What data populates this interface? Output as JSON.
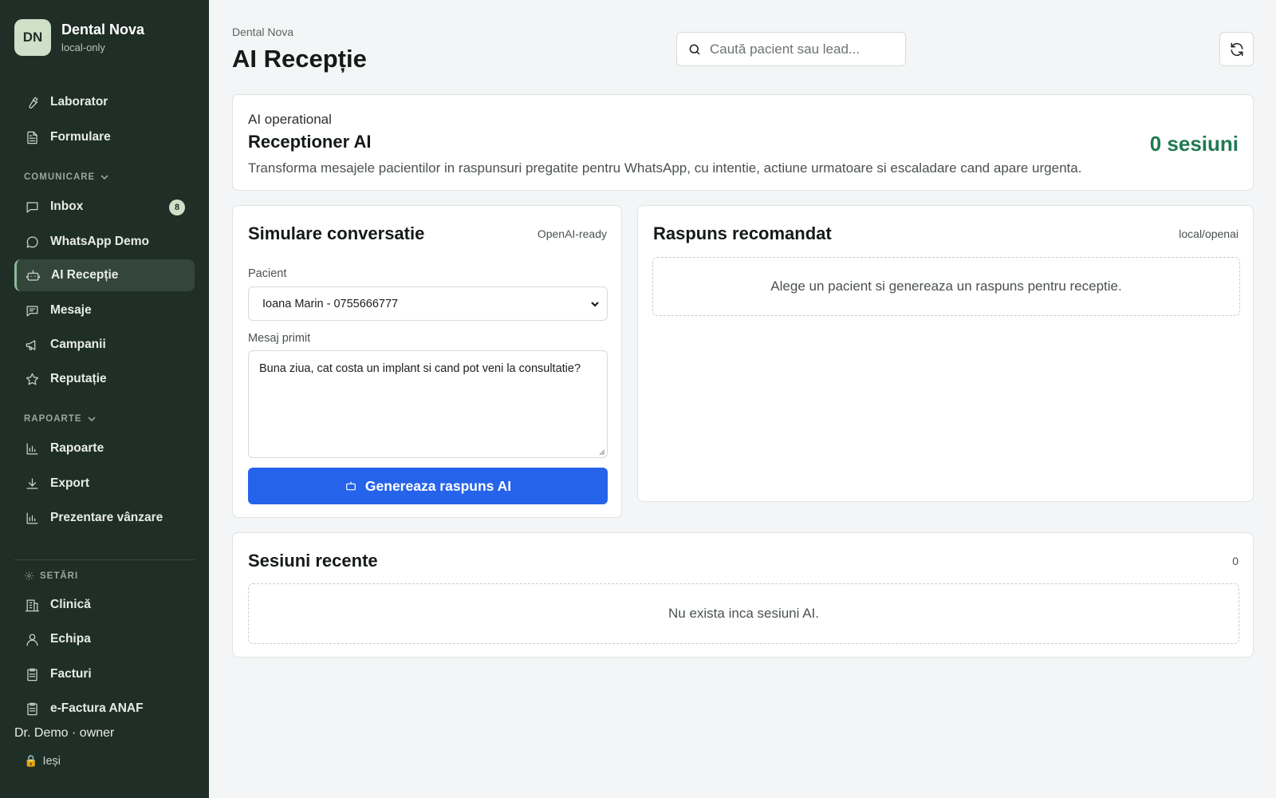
{
  "brand": {
    "initials": "DN",
    "name": "Dental Nova",
    "subtitle": "local-only"
  },
  "sidebar": {
    "items_top": [
      {
        "label": "Laborator",
        "icon": "wrench-icon"
      },
      {
        "label": "Formulare",
        "icon": "document-icon"
      }
    ],
    "section_comunicare": "COMUNICARE",
    "items_comunicare": [
      {
        "label": "Inbox",
        "icon": "message-square-icon",
        "badge": "8"
      },
      {
        "label": "WhatsApp Demo",
        "icon": "message-circle-icon"
      },
      {
        "label": "AI Recepție",
        "icon": "bot-icon",
        "active": true
      },
      {
        "label": "Mesaje",
        "icon": "message-lines-icon"
      },
      {
        "label": "Campanii",
        "icon": "megaphone-icon"
      },
      {
        "label": "Reputație",
        "icon": "star-icon"
      }
    ],
    "section_rapoarte": "RAPOARTE",
    "items_rapoarte": [
      {
        "label": "Rapoarte",
        "icon": "bar-chart-icon"
      },
      {
        "label": "Export",
        "icon": "download-icon"
      },
      {
        "label": "Prezentare vânzare",
        "icon": "bar-chart-icon"
      }
    ],
    "section_setari": "SETĂRI",
    "items_setari": [
      {
        "label": "Clinică",
        "icon": "building-icon"
      },
      {
        "label": "Echipa",
        "icon": "user-icon"
      },
      {
        "label": "Facturi",
        "icon": "clipboard-icon"
      },
      {
        "label": "e-Factura ANAF",
        "icon": "clipboard-icon"
      }
    ],
    "user": "Dr. Demo · owner",
    "logout": "Ieși"
  },
  "header": {
    "breadcrumb": "Dental Nova",
    "title": "AI Recepție",
    "search_placeholder": "Caută pacient sau lead..."
  },
  "hero": {
    "kicker": "AI operational",
    "title": "Receptioner AI",
    "description": "Transforma mesajele pacientilor in raspunsuri pregatite pentru WhatsApp, cu intentie, actiune urmatoare si escaladare cand apare urgenta.",
    "count": "0 sesiuni"
  },
  "simulation": {
    "title": "Simulare conversatie",
    "meta": "OpenAI-ready",
    "patient_label": "Pacient",
    "patient_value": "Ioana Marin - 0755666777",
    "message_label": "Mesaj primit",
    "message_value": "Buna ziua, cat costa un implant si cand pot veni la consultatie?",
    "button": "Genereaza raspuns AI"
  },
  "response": {
    "title": "Raspuns recomandat",
    "meta": "local/openai",
    "empty": "Alege un pacient si genereaza un raspuns pentru receptie."
  },
  "recent": {
    "title": "Sesiuni recente",
    "count": "0",
    "empty": "Nu exista inca sesiuni AI."
  },
  "colors": {
    "sidebar": "#1f2e26",
    "accent": "#2563eb",
    "success": "#1f7a52"
  }
}
